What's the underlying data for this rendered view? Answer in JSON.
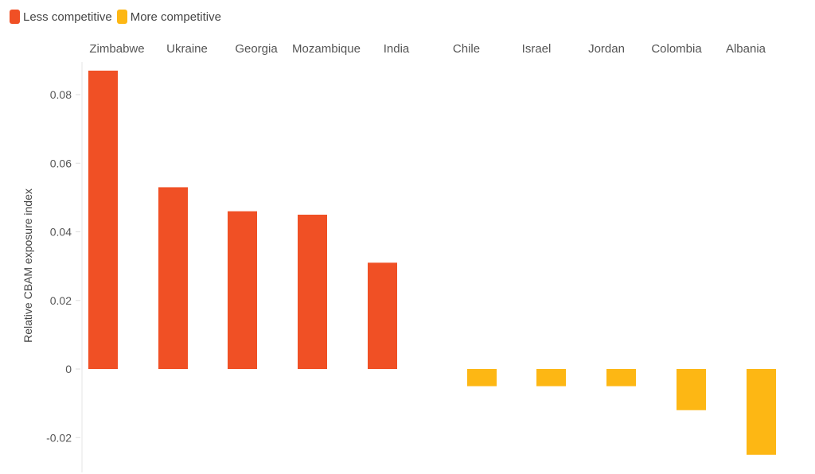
{
  "chart_data": {
    "type": "bar",
    "title": "",
    "xlabel": "",
    "ylabel": "Relative CBAM exposure index",
    "ylim": [
      -0.0295,
      0.0925
    ],
    "yticks": [
      -0.02,
      0,
      0.02,
      0.04,
      0.06,
      0.08
    ],
    "ytick_labels": [
      "-0.02",
      "0",
      "0.02",
      "0.04",
      "0.06",
      "0.08"
    ],
    "categories": [
      "Zimbabwe",
      "Ukraine",
      "Georgia",
      "Mozambique",
      "India",
      "Chile",
      "Israel",
      "Jordan",
      "Colombia",
      "Albania"
    ],
    "values": [
      0.087,
      0.053,
      0.046,
      0.045,
      0.031,
      -0.005,
      -0.005,
      -0.005,
      -0.012,
      -0.025
    ],
    "groups": [
      "Less competitive",
      "Less competitive",
      "Less competitive",
      "Less competitive",
      "Less competitive",
      "More competitive",
      "More competitive",
      "More competitive",
      "More competitive",
      "More competitive"
    ],
    "legend": [
      {
        "label": "Less competitive",
        "color": "#F05025"
      },
      {
        "label": "More competitive",
        "color": "#FDB714"
      }
    ],
    "legend_position": "top-left",
    "category_labels_position": "top",
    "grid": false
  }
}
